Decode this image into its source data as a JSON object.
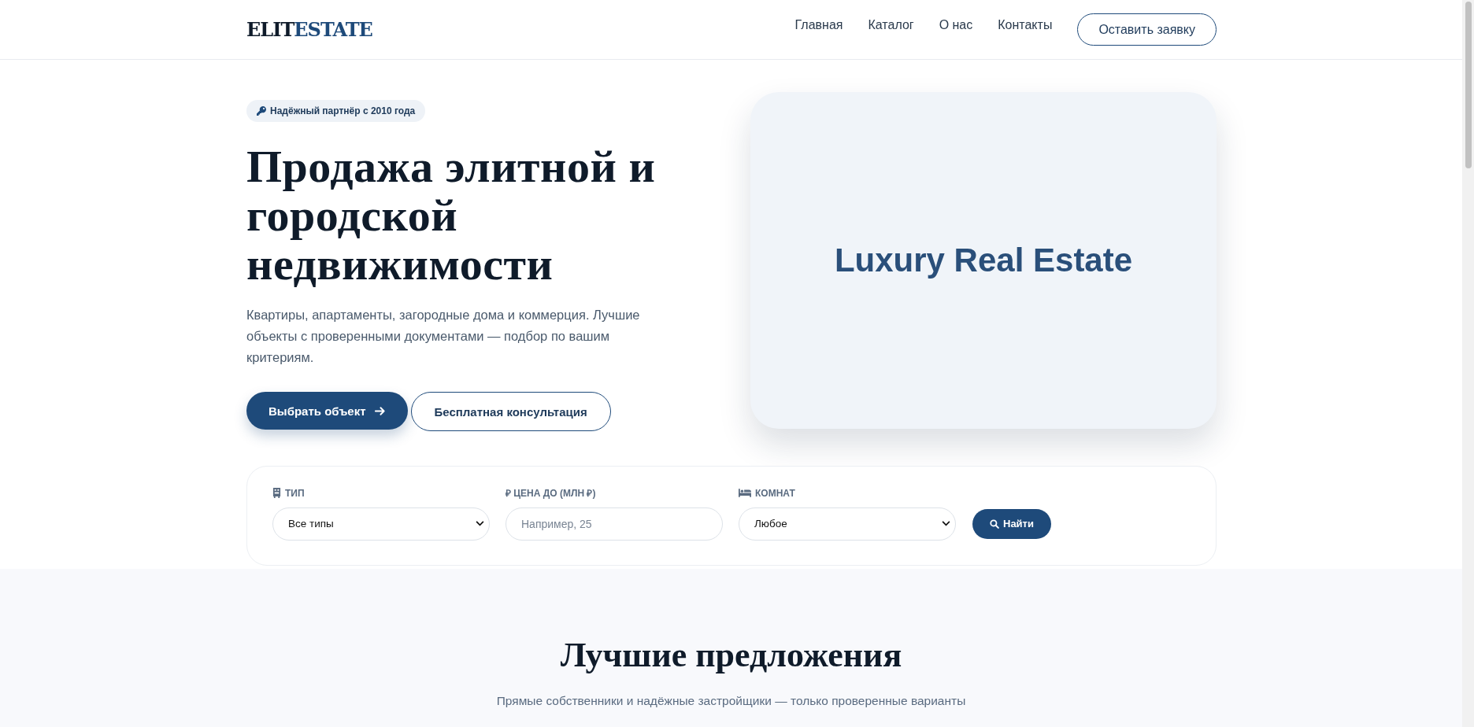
{
  "logo": {
    "part1": "ELIT",
    "part2": "ESTATE"
  },
  "nav": {
    "links": [
      "Главная",
      "Каталог",
      "О нас",
      "Контакты"
    ],
    "cta": "Оставить заявку"
  },
  "hero": {
    "badge": "Надёжный партнёр с 2010 года",
    "title": "Продажа элитной и городской недвижимости",
    "text": "Квартиры, апартаменты, загородные дома и коммерция. Лучшие объекты с проверенными документами — подбор по вашим критериям.",
    "primary_button": "Выбрать объект",
    "secondary_button": "Бесплатная консультация",
    "image_text": "Luxury Real Estate"
  },
  "search": {
    "fields": [
      {
        "kind": "select",
        "label": "ТИП",
        "value": "Все типы"
      },
      {
        "kind": "input",
        "label": "₽ ЦЕНА ДО (МЛН ₽)",
        "placeholder": "Например, 25"
      },
      {
        "kind": "select",
        "label": "КОМНАТ",
        "value": "Любое"
      }
    ],
    "button": "Найти"
  },
  "offers": {
    "title": "Лучшие предложения",
    "subtitle": "Прямые собственники и надёжные застройщики — только проверенные варианты"
  }
}
